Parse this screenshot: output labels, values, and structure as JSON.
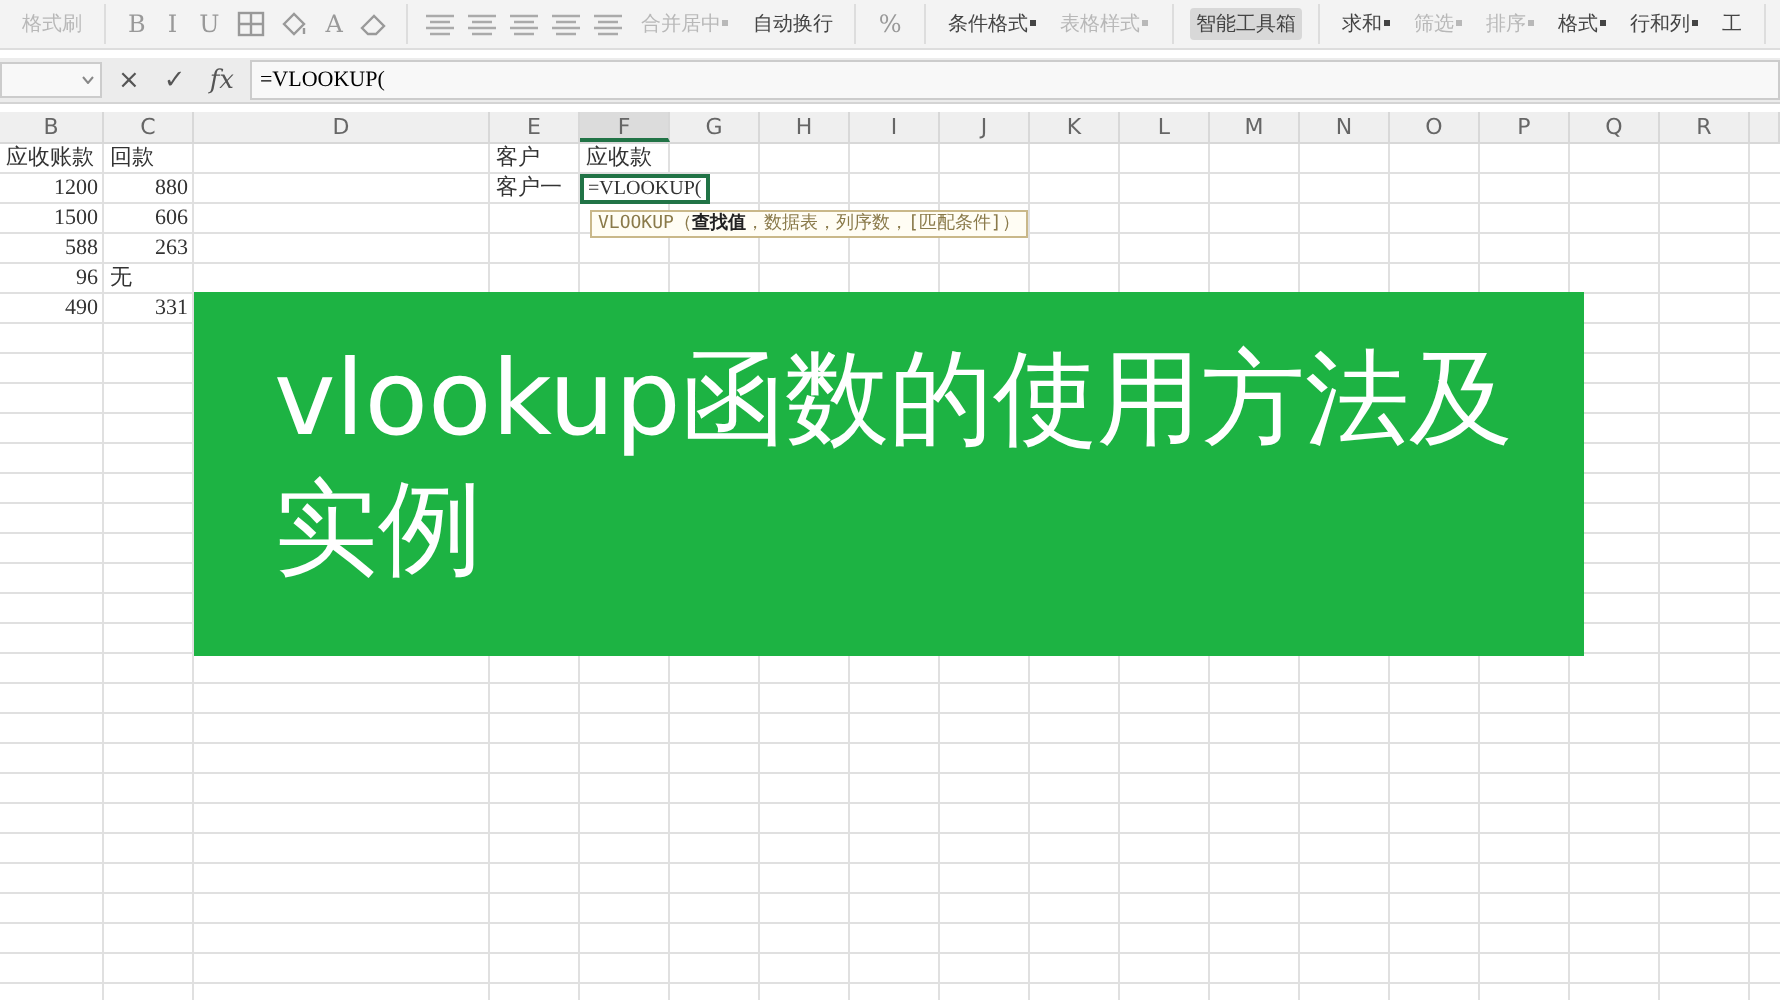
{
  "toolbar": {
    "groups": [
      [
        {
          "kind": "label",
          "label": "格式刷",
          "disabled": true
        }
      ],
      [
        {
          "kind": "glyph",
          "label": "B",
          "disabled": false
        },
        {
          "kind": "glyph",
          "label": "I",
          "disabled": false
        },
        {
          "kind": "glyph",
          "label": "U",
          "disabled": false
        },
        {
          "kind": "border",
          "disabled": false
        },
        {
          "kind": "fill",
          "disabled": false
        },
        {
          "kind": "glyph",
          "label": "A",
          "disabled": false
        },
        {
          "kind": "eraser",
          "disabled": false
        }
      ],
      [
        {
          "kind": "align",
          "disabled": false
        },
        {
          "kind": "align",
          "disabled": false
        },
        {
          "kind": "align",
          "disabled": false
        },
        {
          "kind": "align",
          "disabled": false
        },
        {
          "kind": "align",
          "disabled": false
        },
        {
          "kind": "label",
          "label": "合并居中",
          "dropdown": true,
          "disabled": true
        },
        {
          "kind": "label",
          "label": "自动换行",
          "dropdown": false,
          "disabled": false
        }
      ],
      [
        {
          "kind": "glyph",
          "label": "%",
          "disabled": false
        }
      ],
      [
        {
          "kind": "label",
          "label": "条件格式",
          "dropdown": true,
          "disabled": false
        },
        {
          "kind": "label",
          "label": "表格样式",
          "dropdown": true,
          "disabled": true
        }
      ],
      [
        {
          "kind": "label",
          "label": "智能工具箱",
          "dropdown": false,
          "selected": true,
          "disabled": false
        }
      ],
      [
        {
          "kind": "label",
          "label": "求和",
          "dropdown": true,
          "disabled": false
        },
        {
          "kind": "label",
          "label": "筛选",
          "dropdown": true,
          "disabled": true
        },
        {
          "kind": "label",
          "label": "排序",
          "dropdown": true,
          "disabled": true
        },
        {
          "kind": "label",
          "label": "格式",
          "dropdown": true,
          "disabled": false
        },
        {
          "kind": "label",
          "label": "行和列",
          "dropdown": true,
          "disabled": false
        },
        {
          "kind": "label",
          "label": "工",
          "dropdown": false,
          "disabled": false
        }
      ]
    ]
  },
  "formula_bar": {
    "buttons": [
      "×",
      "✓",
      "fx"
    ],
    "value": "=VLOOKUP("
  },
  "sheet": {
    "columns": [
      {
        "label": "B",
        "selected": false
      },
      {
        "label": "C",
        "selected": false
      },
      {
        "label": "D",
        "selected": false
      },
      {
        "label": "E",
        "selected": false
      },
      {
        "label": "F",
        "selected": true
      },
      {
        "label": "G",
        "selected": false
      },
      {
        "label": "H",
        "selected": false
      },
      {
        "label": "I",
        "selected": false
      },
      {
        "label": "J",
        "selected": false
      },
      {
        "label": "K",
        "selected": false
      },
      {
        "label": "L",
        "selected": false
      },
      {
        "label": "M",
        "selected": false
      },
      {
        "label": "N",
        "selected": false
      },
      {
        "label": "O",
        "selected": false
      },
      {
        "label": "P",
        "selected": false
      },
      {
        "label": "Q",
        "selected": false
      },
      {
        "label": "R",
        "selected": false
      }
    ],
    "rows": [
      {
        "cells": [
          {
            "text": "应收账款",
            "kind": "text"
          },
          {
            "text": "回款",
            "kind": "text"
          },
          {
            "kind": "empty"
          },
          {
            "text": "客户",
            "kind": "text"
          },
          {
            "text": "应收款",
            "kind": "text"
          }
        ]
      },
      {
        "cells": [
          {
            "text": "1200",
            "kind": "number"
          },
          {
            "text": "880",
            "kind": "number"
          },
          {
            "kind": "empty"
          },
          {
            "text": "客户一",
            "kind": "text"
          },
          {
            "text": "=VLOOKUP(",
            "kind": "editing"
          }
        ]
      },
      {
        "cells": [
          {
            "text": "1500",
            "kind": "number"
          },
          {
            "text": "606",
            "kind": "number"
          }
        ]
      },
      {
        "cells": [
          {
            "text": "588",
            "kind": "number"
          },
          {
            "text": "263",
            "kind": "number"
          }
        ]
      },
      {
        "cells": [
          {
            "text": "96",
            "kind": "number"
          },
          {
            "text": "无",
            "kind": "text"
          }
        ]
      },
      {
        "cells": [
          {
            "text": "490",
            "kind": "number"
          },
          {
            "text": "331",
            "kind": "number"
          }
        ]
      }
    ],
    "tooltip": "VLOOKUP（**查找值**，数据表，列序数，[匹配条件]）"
  },
  "banner": {
    "title": "vlookup函数的使用方法及实例"
  }
}
